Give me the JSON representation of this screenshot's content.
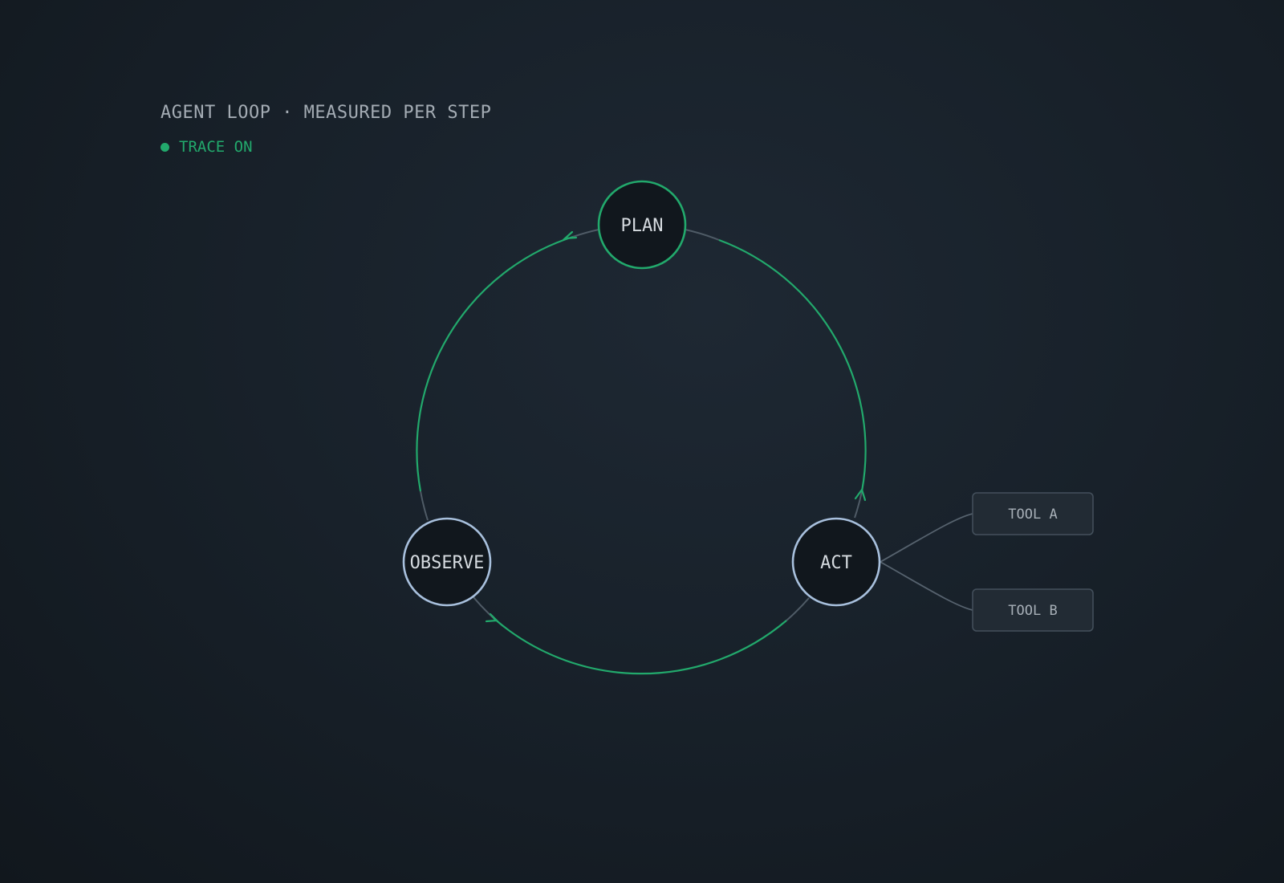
{
  "header": {
    "title": "AGENT LOOP · MEASURED PER STEP",
    "status": "TRACE ON"
  },
  "nodes": {
    "plan": "PLAN",
    "act": "ACT",
    "observe": "OBSERVE"
  },
  "tools": {
    "a": "TOOL A",
    "b": "TOOL B"
  },
  "colors": {
    "accent": "#22a96c",
    "node_outline": "#a8c0dd",
    "muted_line": "#54606c"
  }
}
